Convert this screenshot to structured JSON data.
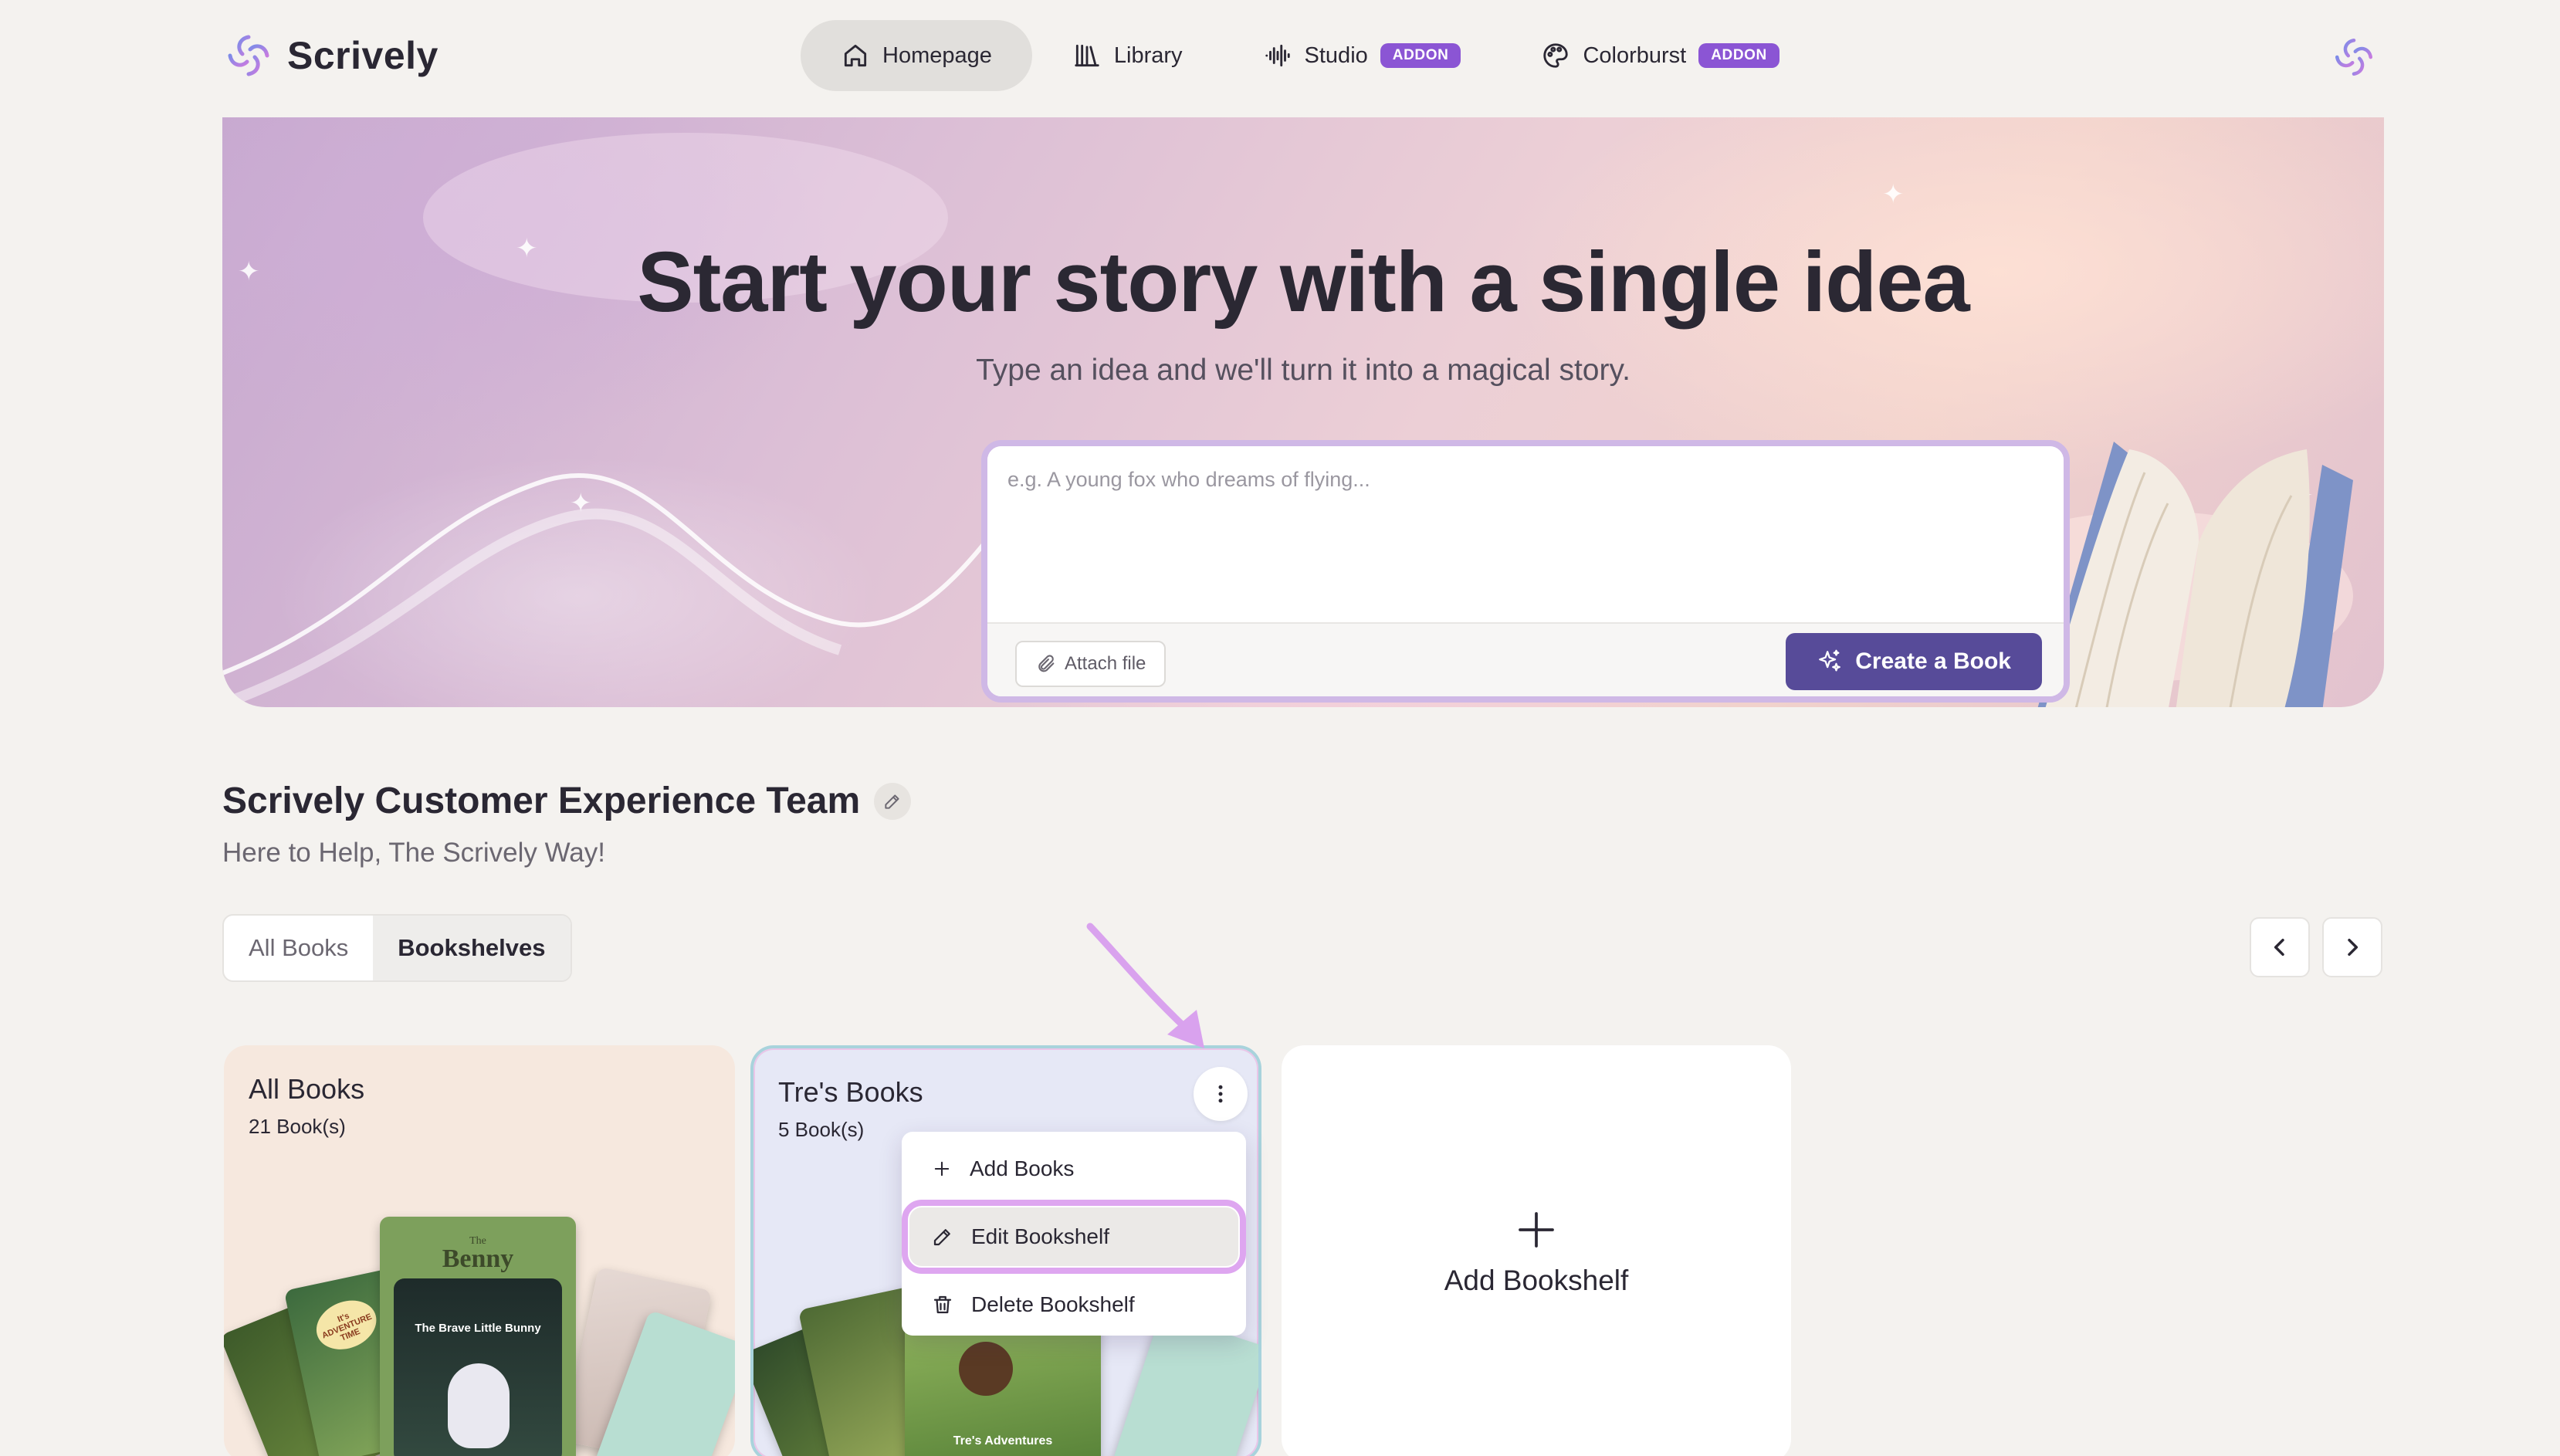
{
  "brand": {
    "name": "Scrively"
  },
  "nav": {
    "items": [
      {
        "label": "Homepage",
        "icon": "home-icon"
      },
      {
        "label": "Library",
        "icon": "library-icon"
      },
      {
        "label": "Studio",
        "icon": "audio-wave-icon",
        "badge": "ADDON"
      },
      {
        "label": "Colorburst",
        "icon": "palette-icon",
        "badge": "ADDON"
      }
    ],
    "active": "Homepage"
  },
  "hero": {
    "title": "Start your story with a single idea",
    "subtitle": "Type an idea and we'll turn it into a magical story.",
    "input_placeholder": "e.g. A young fox who dreams of flying...",
    "attach_label": "Attach file",
    "create_label": "Create a Book"
  },
  "profile": {
    "name": "Scrively Customer Experience Team",
    "tagline": "Here to Help, The Scrively Way!"
  },
  "tabs": {
    "all_books": "All Books",
    "bookshelves": "Bookshelves",
    "active": "Bookshelves"
  },
  "shelves": [
    {
      "title": "All Books",
      "count": "21 Book(s)"
    },
    {
      "title": "Tre's Books",
      "count": "5 Book(s)"
    }
  ],
  "add_shelf_label": "Add Bookshelf",
  "shelf_menu": {
    "items": [
      {
        "label": "Add Books",
        "icon": "plus-icon"
      },
      {
        "label": "Edit Bookshelf",
        "icon": "pencil-icon"
      },
      {
        "label": "Delete Bookshelf",
        "icon": "trash-icon"
      }
    ],
    "highlighted": "Edit Bookshelf"
  },
  "covers": {
    "benny_top": "The",
    "benny_title": "Benny",
    "brave_bunny": "The Brave Little Bunny",
    "adventure_tree": "It's ADVENTURE TIME",
    "tres_adventures": "Tre's Adventures"
  },
  "colors": {
    "accent": "#574b99",
    "addon_badge": "#8b55d4",
    "highlight_outline": "#dea6f0",
    "page_bg": "#f4f2ef"
  }
}
